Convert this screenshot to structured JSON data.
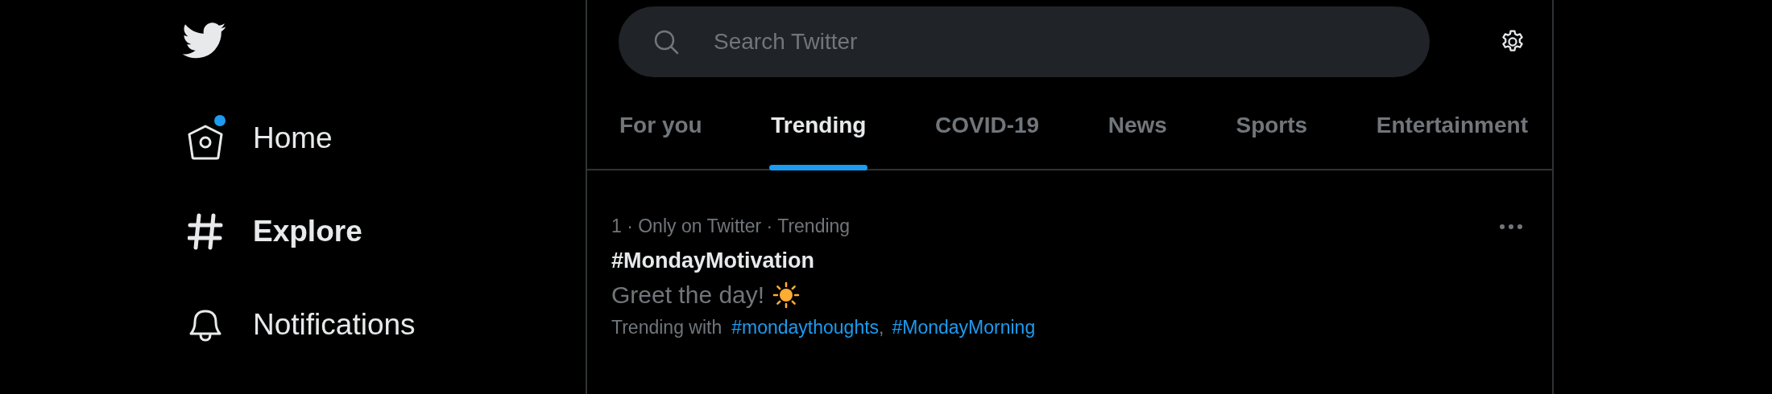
{
  "sidebar": {
    "items": [
      {
        "label": "Home",
        "kind": "home",
        "selected": false,
        "badge": true
      },
      {
        "label": "Explore",
        "kind": "explore",
        "selected": true,
        "badge": false
      },
      {
        "label": "Notifications",
        "kind": "bell",
        "selected": false,
        "badge": false
      }
    ]
  },
  "search": {
    "placeholder": "Search Twitter"
  },
  "tabs": [
    {
      "label": "For you",
      "selected": false
    },
    {
      "label": "Trending",
      "selected": true
    },
    {
      "label": "COVID-19",
      "selected": false
    },
    {
      "label": "News",
      "selected": false
    },
    {
      "label": "Sports",
      "selected": false
    },
    {
      "label": "Entertainment",
      "selected": false
    }
  ],
  "trends": [
    {
      "meta": "1 · Only on Twitter · Trending",
      "title": "#MondayMotivation",
      "description": "Greet the day!",
      "trending_with_label": "Trending with",
      "related": [
        "#mondaythoughts",
        "#MondayMorning"
      ],
      "separator": ","
    }
  ]
}
